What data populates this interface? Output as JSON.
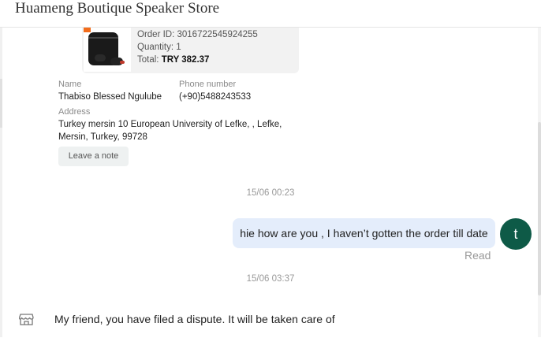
{
  "header": {
    "title": "Huameng Boutique Speaker Store"
  },
  "order": {
    "order_id": "Order ID: 3016722545924255",
    "quantity": "Quantity: 1",
    "total_label": "Total:",
    "total_value": "TRY 382.37",
    "product_icon": "earbuds-product-image"
  },
  "shipping": {
    "name_label": "Name",
    "name_value": "Thabiso Blessed Ngulube",
    "phone_label": "Phone number",
    "phone_value": "(+90)5488243533",
    "address_label": "Address",
    "address_line1": "Turkey mersin 10 European University of Lefke, , Lefke,",
    "address_line2": "Mersin, Turkey, 99728",
    "note_button": "Leave a note"
  },
  "messages": [
    {
      "timestamp": "15/06 00:23",
      "text": "hie how are you , I haven’t gotten the order till date",
      "status": "Read",
      "avatar_letter": "t"
    },
    {
      "timestamp": "15/06 03:37",
      "text": "My friend, you have filed a dispute. It will be taken care of",
      "icon": "shop-icon"
    }
  ],
  "colors": {
    "avatar": "#0e5a47",
    "outgoing_bubble": "#e4edfb",
    "order_card": "#f2f2f2"
  }
}
